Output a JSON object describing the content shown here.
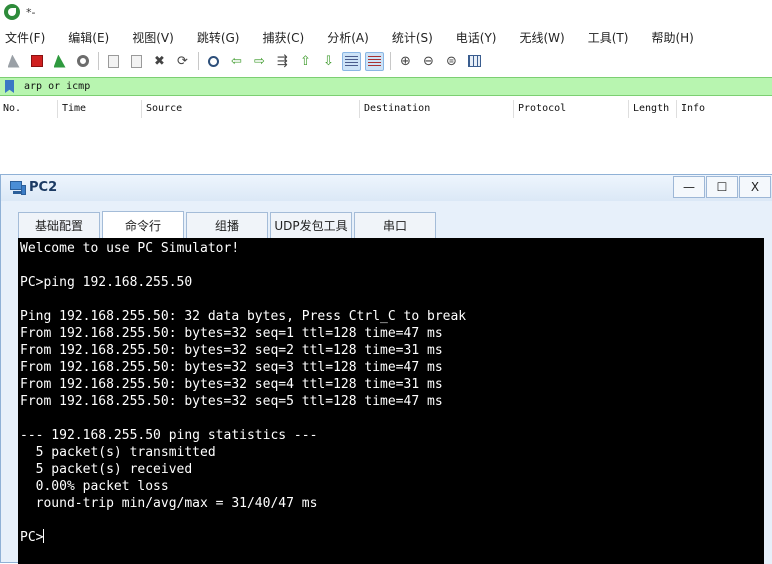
{
  "wireshark": {
    "title": "*-",
    "menu": [
      "文件(F)",
      "编辑(E)",
      "视图(V)",
      "跳转(G)",
      "捕获(C)",
      "分析(A)",
      "统计(S)",
      "电话(Y)",
      "无线(W)",
      "工具(T)",
      "帮助(H)"
    ],
    "display_filter": "arp or icmp",
    "columns": [
      "No.",
      "Time",
      "Source",
      "Destination",
      "Protocol",
      "Length",
      "Info"
    ]
  },
  "pc_window": {
    "title": "PC2",
    "minimize": "—",
    "maximize": "☐",
    "close": "X",
    "tabs": [
      "基础配置",
      "命令行",
      "组播",
      "UDP发包工具",
      "串口"
    ],
    "active_tab": "命令行",
    "terminal_lines": [
      "Welcome to use PC Simulator!",
      "",
      "PC>ping 192.168.255.50",
      "",
      "Ping 192.168.255.50: 32 data bytes, Press Ctrl_C to break",
      "From 192.168.255.50: bytes=32 seq=1 ttl=128 time=47 ms",
      "From 192.168.255.50: bytes=32 seq=2 ttl=128 time=31 ms",
      "From 192.168.255.50: bytes=32 seq=3 ttl=128 time=47 ms",
      "From 192.168.255.50: bytes=32 seq=4 ttl=128 time=31 ms",
      "From 192.168.255.50: bytes=32 seq=5 ttl=128 time=47 ms",
      "",
      "--- 192.168.255.50 ping statistics ---",
      "  5 packet(s) transmitted",
      "  5 packet(s) received",
      "  0.00% packet loss",
      "  round-trip min/avg/max = 31/40/47 ms",
      ""
    ],
    "prompt": "PC>"
  }
}
